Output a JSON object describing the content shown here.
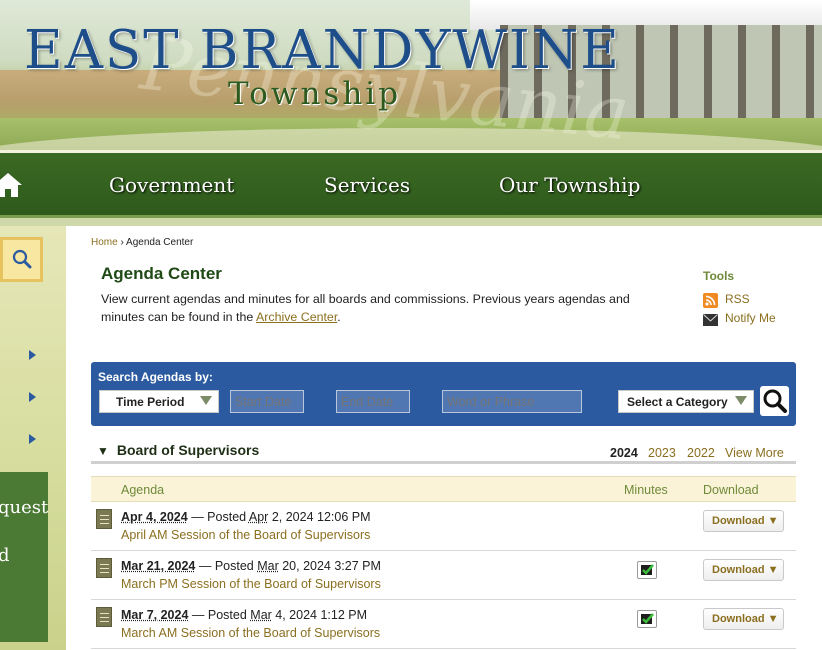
{
  "header": {
    "title_line1": "EAST BRANDYWINE",
    "title_line2": "Township",
    "watermark": "Pennsylvania"
  },
  "nav": {
    "home_icon": "home-icon",
    "items": [
      {
        "label": "Government"
      },
      {
        "label": "Services"
      },
      {
        "label": "Our Township"
      }
    ]
  },
  "sidebar": {
    "search_icon": "search-icon",
    "partial_text": [
      "quest",
      "d"
    ]
  },
  "breadcrumb": {
    "home": "Home",
    "sep": "›",
    "current": "Agenda Center"
  },
  "page": {
    "title": "Agenda Center",
    "intro_before": "View current agendas and minutes for all boards and commissions. Previous years agendas and minutes can be found in the ",
    "intro_link": "Archive Center",
    "intro_after": "."
  },
  "tools": {
    "heading": "Tools",
    "rss": "RSS",
    "notify": "Notify Me"
  },
  "search": {
    "label": "Search Agendas by:",
    "time_period": "Time Period",
    "start_date_placeholder": "Start Date",
    "end_date_placeholder": "End Date",
    "phrase_placeholder": "Word or Phrase",
    "category": "Select a Category"
  },
  "board": {
    "name": "Board of Supervisors",
    "years": [
      "2024",
      "2023",
      "2022"
    ],
    "view_more": "View More",
    "columns": {
      "agenda": "Agenda",
      "minutes": "Minutes",
      "download": "Download"
    },
    "rows": [
      {
        "date": "Apr 4, 2024",
        "posted_prefix": "— Posted ",
        "posted_mon": "Apr",
        "posted_rest": " 2, 2024 12:06 PM",
        "title": "April AM Session of the Board of Supervisors",
        "has_minutes": false,
        "download": "Download ▼"
      },
      {
        "date": "Mar 21, 2024",
        "posted_prefix": "— Posted ",
        "posted_mon": "Mar",
        "posted_rest": " 20, 2024 3:27 PM",
        "title": "March PM Session of the Board of Supervisors",
        "has_minutes": true,
        "download": "Download ▼"
      },
      {
        "date": "Mar 7, 2024",
        "posted_prefix": "— Posted ",
        "posted_mon": "Mar",
        "posted_rest": " 4, 2024 1:12 PM",
        "title": "March AM Session of the Board of Supervisors",
        "has_minutes": true,
        "download": "Download ▼"
      }
    ]
  },
  "colors": {
    "nav_green": "#2e5a1b",
    "search_blue": "#2b5aa0",
    "link_gold": "#8b6f20"
  }
}
